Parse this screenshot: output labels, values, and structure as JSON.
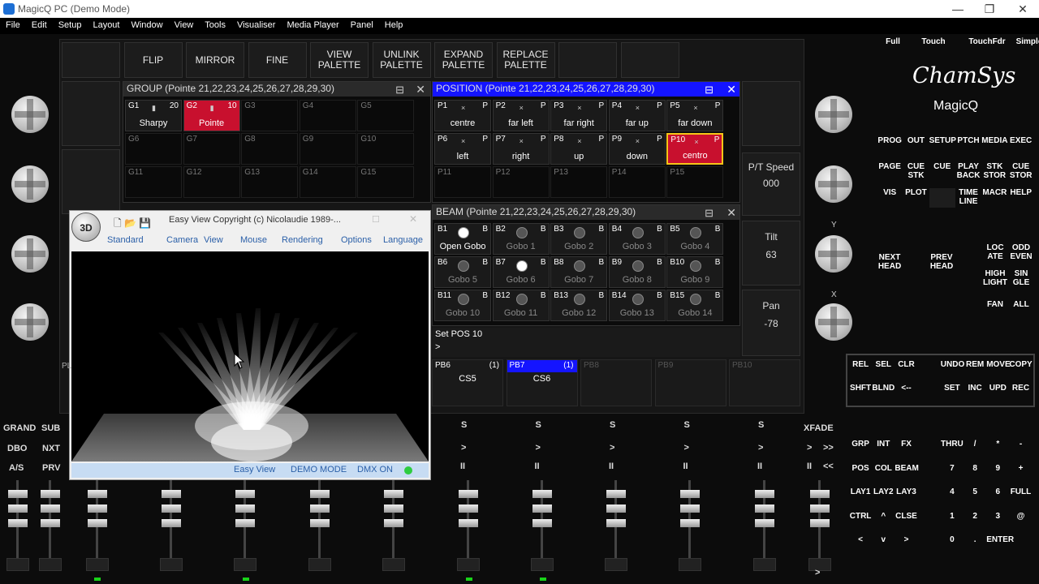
{
  "window": {
    "title": "MagicQ PC (Demo Mode)",
    "min": "—",
    "max": "❐",
    "close": "✕"
  },
  "menu": [
    "File",
    "Edit",
    "Setup",
    "Layout",
    "Window",
    "View",
    "Tools",
    "Visualiser",
    "Media Player",
    "Panel",
    "Help"
  ],
  "toolbar": [
    "",
    "FLIP",
    "MIRROR",
    "FINE",
    "VIEW\nPALETTE",
    "UNLINK\nPALETTE",
    "EXPAND\nPALETTE",
    "REPLACE\nPALETTE",
    "",
    ""
  ],
  "view_modes": [
    "Full",
    "Touch",
    "TouchFdr",
    "Simple"
  ],
  "brand": {
    "logo": "ChamSys",
    "product": "MagicQ"
  },
  "group": {
    "title": "GROUP (Pointe 21,22,23,24,25,26,27,28,29,30)",
    "cells": [
      {
        "n": "G1",
        "r": "20",
        "label": "Sharpy",
        "sel": false
      },
      {
        "n": "G2",
        "r": "10",
        "label": "Pointe",
        "sel": true
      },
      {
        "n": "G3",
        "r": "",
        "label": "",
        "sel": false
      },
      {
        "n": "G4",
        "r": "",
        "label": "",
        "sel": false
      },
      {
        "n": "G5",
        "r": "",
        "label": "",
        "sel": false
      },
      {
        "n": "G6",
        "r": "",
        "label": "",
        "sel": false
      },
      {
        "n": "G7",
        "r": "",
        "label": "",
        "sel": false
      },
      {
        "n": "G8",
        "r": "",
        "label": "",
        "sel": false
      },
      {
        "n": "G9",
        "r": "",
        "label": "",
        "sel": false
      },
      {
        "n": "G10",
        "r": "",
        "label": "",
        "sel": false
      },
      {
        "n": "G11",
        "r": "",
        "label": "",
        "sel": false
      },
      {
        "n": "G12",
        "r": "",
        "label": "",
        "sel": false
      },
      {
        "n": "G13",
        "r": "",
        "label": "",
        "sel": false
      },
      {
        "n": "G14",
        "r": "",
        "label": "",
        "sel": false
      },
      {
        "n": "G15",
        "r": "",
        "label": "",
        "sel": false
      }
    ]
  },
  "position": {
    "title": "POSITION (Pointe 21,22,23,24,25,26,27,28,29,30)",
    "cells": [
      {
        "n": "P1",
        "r": "P",
        "label": "centre",
        "sel": false
      },
      {
        "n": "P2",
        "r": "P",
        "label": "far left",
        "sel": false
      },
      {
        "n": "P3",
        "r": "P",
        "label": "far right",
        "sel": false
      },
      {
        "n": "P4",
        "r": "P",
        "label": "far up",
        "sel": false
      },
      {
        "n": "P5",
        "r": "P",
        "label": "far down",
        "sel": false
      },
      {
        "n": "P6",
        "r": "P",
        "label": "left",
        "sel": false
      },
      {
        "n": "P7",
        "r": "P",
        "label": "right",
        "sel": false
      },
      {
        "n": "P8",
        "r": "P",
        "label": "up",
        "sel": false
      },
      {
        "n": "P9",
        "r": "P",
        "label": "down",
        "sel": false
      },
      {
        "n": "P10",
        "r": "P",
        "label": "centro",
        "sel": true
      },
      {
        "n": "P11",
        "r": "",
        "label": "",
        "sel": false
      },
      {
        "n": "P12",
        "r": "",
        "label": "",
        "sel": false
      },
      {
        "n": "P13",
        "r": "",
        "label": "",
        "sel": false
      },
      {
        "n": "P14",
        "r": "",
        "label": "",
        "sel": false
      },
      {
        "n": "P15",
        "r": "",
        "label": "",
        "sel": false
      }
    ]
  },
  "beam": {
    "title": "BEAM (Pointe 21,22,23,24,25,26,27,28,29,30)",
    "cells": [
      {
        "n": "B1",
        "r": "B",
        "label": "Open Gobo"
      },
      {
        "n": "B2",
        "r": "B",
        "label": "Gobo 1"
      },
      {
        "n": "B3",
        "r": "B",
        "label": "Gobo 2"
      },
      {
        "n": "B4",
        "r": "B",
        "label": "Gobo 3"
      },
      {
        "n": "B5",
        "r": "B",
        "label": "Gobo 4"
      },
      {
        "n": "B6",
        "r": "B",
        "label": "Gobo 5"
      },
      {
        "n": "B7",
        "r": "B",
        "label": "Gobo 6"
      },
      {
        "n": "B8",
        "r": "B",
        "label": "Gobo 7"
      },
      {
        "n": "B9",
        "r": "B",
        "label": "Gobo 8"
      },
      {
        "n": "B10",
        "r": "B",
        "label": "Gobo 9"
      },
      {
        "n": "B11",
        "r": "B",
        "label": "Gobo 10"
      },
      {
        "n": "B12",
        "r": "B",
        "label": "Gobo 11"
      },
      {
        "n": "B13",
        "r": "B",
        "label": "Gobo 12"
      },
      {
        "n": "B14",
        "r": "B",
        "label": "Gobo 13"
      },
      {
        "n": "B15",
        "r": "B",
        "label": "Gobo 14"
      }
    ]
  },
  "encoders": {
    "pt_speed": {
      "label": "P/T Speed",
      "value": "000"
    },
    "tilt": {
      "label": "Tilt",
      "value": "63"
    },
    "pan": {
      "label": "Pan",
      "value": "-78"
    },
    "y_label": "Y",
    "x_label": "X"
  },
  "cmdline": {
    "text": "Set POS 10",
    "prompt": ">"
  },
  "playbacks": [
    {
      "name": "PB6",
      "count": "(1)",
      "label": "CS5"
    },
    {
      "name": "PB7",
      "count": "(1)",
      "label": "CS6"
    },
    {
      "name": "PB8",
      "count": "",
      "label": ""
    },
    {
      "name": "PB9",
      "count": "",
      "label": ""
    },
    {
      "name": "PB10",
      "count": "",
      "label": ""
    }
  ],
  "easyview": {
    "title": "Easy View   Copyright (c) Nicolaudie 1989-...",
    "logo": "3D",
    "menu": [
      "Standard",
      "Camera",
      "View",
      "Mouse",
      "Rendering",
      "Options",
      "Language"
    ],
    "status": [
      "Easy View",
      "DEMO MODE",
      "DMX ON"
    ],
    "pl": "PL"
  },
  "right_keys": [
    [
      "PROG",
      "OUT",
      "SETUP",
      "PTCH",
      "MEDIA",
      "EXEC"
    ],
    [
      "PAGE",
      "CUE\nSTK",
      "CUE",
      "PLAY\nBACK",
      "STK\nSTOR",
      "CUE\nSTOR"
    ],
    [
      "VIS",
      "PLOT",
      "",
      "TIME\nLINE",
      "MACR",
      "HELP"
    ]
  ],
  "head_keys": [
    "NEXT\nHEAD",
    "PREV\nHEAD",
    "LOC\nATE",
    "ODD\nEVEN",
    "HIGH\nLIGHT",
    "SIN\nGLE",
    "FAN",
    "ALL"
  ],
  "edit_keys": [
    [
      "REL",
      "SEL",
      "CLR",
      "",
      "UNDO",
      "REM",
      "MOVE",
      "COPY"
    ],
    [
      "SHFT",
      "BLND",
      "<--",
      "",
      "SET",
      "INC",
      "UPD",
      "REC"
    ]
  ],
  "keypad": [
    [
      "GRP",
      "INT",
      "FX",
      "",
      "THRU",
      "/",
      "*",
      "-"
    ],
    [
      "POS",
      "COL",
      "BEAM",
      "",
      "7",
      "8",
      "9",
      "+"
    ],
    [
      "LAY1",
      "LAY2",
      "LAY3",
      "",
      "4",
      "5",
      "6",
      "FULL"
    ],
    [
      "CTRL",
      "^",
      "CLSE",
      "",
      "1",
      "2",
      "3",
      "@"
    ],
    [
      "<",
      "v",
      ">",
      "",
      "0",
      ".",
      "ENTER",
      ""
    ]
  ],
  "grand": {
    "grand": "GRAND",
    "sub": "SUB",
    "dbo": "DBO",
    "nxt": "NXT",
    "as": "A/S",
    "prv": "PRV"
  },
  "xfade": "XFADE",
  "pb_controls": {
    "s": "S",
    ">": ">",
    "pause": "II",
    "ff": ">>",
    "rw": "<<"
  }
}
